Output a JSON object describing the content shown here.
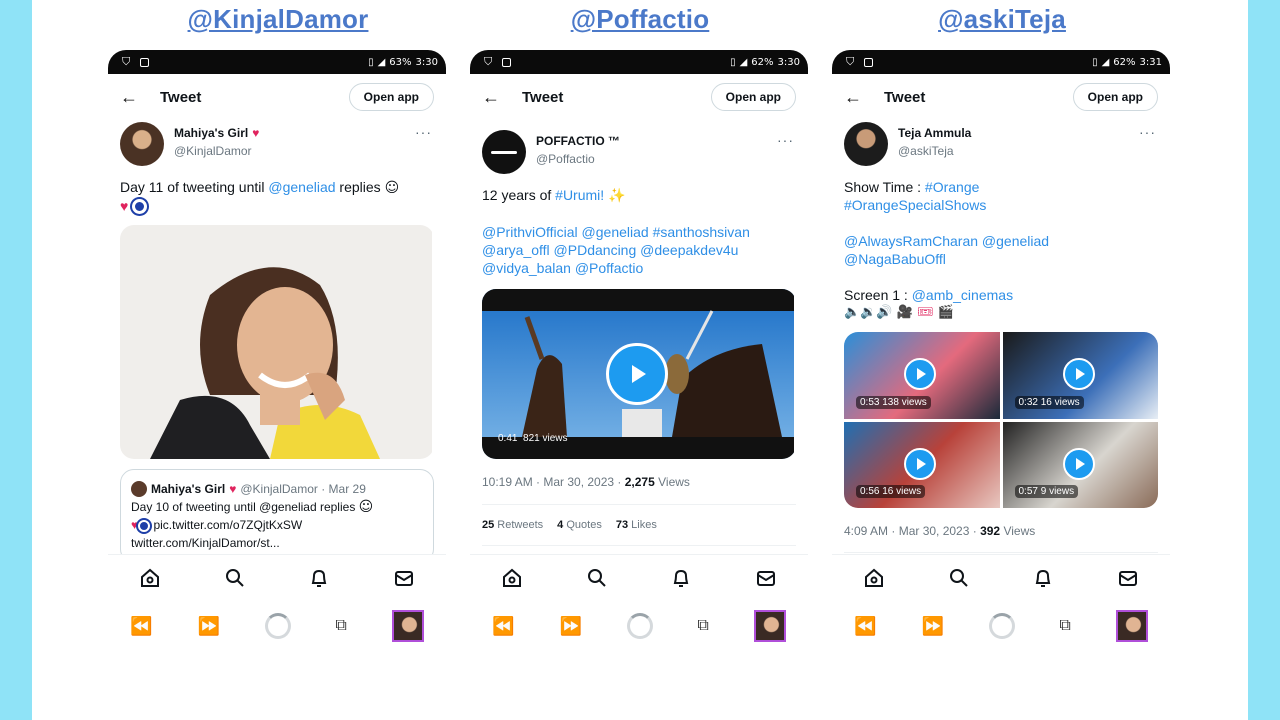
{
  "columns": [
    {
      "handle": "@KinjalDamor",
      "status": {
        "battery": "63%",
        "time": "3:30"
      },
      "header": {
        "title": "Tweet",
        "open_app": "Open app"
      },
      "author": {
        "display_name": "Mahiya's Girl",
        "username": "@KinjalDamor"
      },
      "tweet_text": {
        "prefix": "Day 11 of tweeting until ",
        "mention": "@geneliad",
        "suffix": " replies"
      },
      "quote": {
        "name": "Mahiya's Girl",
        "meta": "@KinjalDamor · Mar 29",
        "line1": "Day 10 of tweeting until @geneliad replies",
        "link": "pic.twitter.com/o7ZQjtKxSW",
        "line3": "twitter.com/KinjalDamor/st..."
      }
    },
    {
      "handle": "@Poffactio",
      "status": {
        "battery": "62%",
        "time": "3:30"
      },
      "header": {
        "title": "Tweet",
        "open_app": "Open app"
      },
      "author": {
        "display_name": "POFFACTIO ™",
        "username": "@Poffactio"
      },
      "tweet_text": {
        "line1_prefix": "12 years of ",
        "line1_tag": "#Urumi!",
        "mentions_1": "@PrithviOfficial @geneliad #santhoshsivan",
        "mentions_2": "@arya_offl @PDdancing @deepakdev4u",
        "mentions_3": "@vidya_balan @Poffactio"
      },
      "video": {
        "duration": "0:41",
        "views": "821 views"
      },
      "timestamp": "10:19 AM · Mar 30, 2023 · ",
      "views_count": "2,275",
      "views_label": " Views",
      "stats": {
        "retweets_count": "25",
        "retweets_label": " Retweets",
        "quotes_count": "4",
        "quotes_label": " Quotes",
        "likes_count": "73",
        "likes_label": " Likes"
      }
    },
    {
      "handle": "@askiTeja",
      "status": {
        "battery": "62%",
        "time": "3:31"
      },
      "header": {
        "title": "Tweet",
        "open_app": "Open app"
      },
      "author": {
        "display_name": "Teja Ammula",
        "username": "@askiTeja"
      },
      "tweet_text": {
        "show_time": "Show Time : ",
        "tag1": "#Orange",
        "tag2": "#OrangeSpecialShows",
        "mentions_1": "@AlwaysRamCharan @geneliad",
        "mentions_2": "@NagaBabuOffl",
        "screen_prefix": "Screen 1 : ",
        "screen_mention": "@amb_cinemas"
      },
      "videos": [
        {
          "duration": "0:53",
          "views": "138 views"
        },
        {
          "duration": "0:32",
          "views": "16 views"
        },
        {
          "duration": "0:56",
          "views": "16 views"
        },
        {
          "duration": "0:57",
          "views": "9 views"
        }
      ],
      "timestamp": "4:09 AM · Mar 30, 2023 · ",
      "views_count": "392",
      "views_label": " Views"
    }
  ],
  "icons": [
    "home-icon",
    "search-icon",
    "bell-icon",
    "mail-icon",
    "rewind-icon",
    "forward-icon",
    "loading-icon",
    "tabs-icon"
  ],
  "colors": {
    "background": "#8fe3f7",
    "handle": "#4b79c9",
    "link": "#2f8fe6",
    "play": "#1d9bf0"
  }
}
